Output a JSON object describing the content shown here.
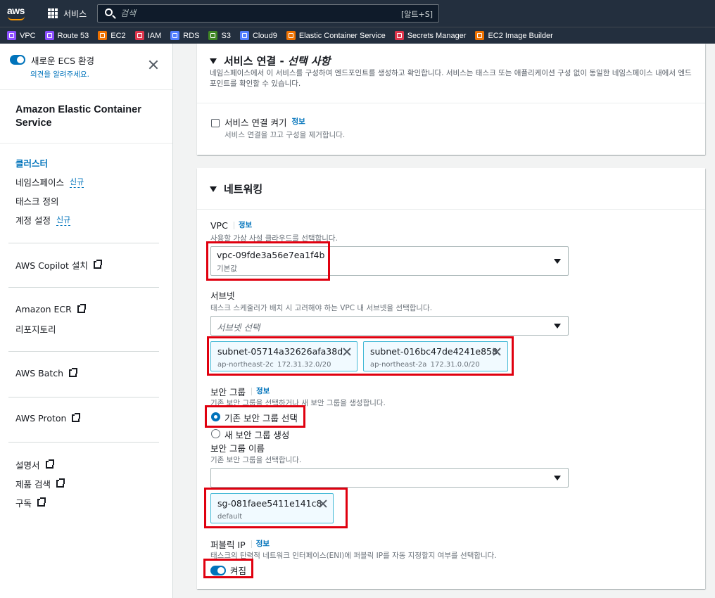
{
  "topbar": {
    "logo": "aws",
    "services": "서비스",
    "search_placeholder": "검색",
    "search_shortcut": "[알트+S]"
  },
  "favorites": [
    {
      "label": "VPC",
      "color": "#8c4fff"
    },
    {
      "label": "Route 53",
      "color": "#8c4fff"
    },
    {
      "label": "EC2",
      "color": "#ed7100"
    },
    {
      "label": "IAM",
      "color": "#dd344c"
    },
    {
      "label": "RDS",
      "color": "#527fff"
    },
    {
      "label": "S3",
      "color": "#3f8624"
    },
    {
      "label": "Cloud9",
      "color": "#527fff"
    },
    {
      "label": "Elastic Container Service",
      "color": "#ed7100"
    },
    {
      "label": "Secrets Manager",
      "color": "#dd344c"
    },
    {
      "label": "EC2 Image Builder",
      "color": "#ed7100"
    }
  ],
  "sidebar": {
    "new_ecs_label": "새로운 ECS 환경",
    "feedback": "의견을 알려주세요.",
    "title": "Amazon Elastic Container Service",
    "nav": [
      {
        "label": "클러스터",
        "badge": ""
      },
      {
        "label": "네임스페이스",
        "badge": "신규"
      },
      {
        "label": "태스크 정의",
        "badge": ""
      },
      {
        "label": "계정 설정",
        "badge": "신규"
      }
    ],
    "links": [
      "AWS Copilot 설치",
      "Amazon ECR",
      "리포지토리",
      "AWS Batch",
      "AWS Proton",
      "설명서",
      "제품 검색",
      "구독"
    ]
  },
  "service_connect": {
    "title_plain": "서비스 연결 - ",
    "title_italic": "선택 사항",
    "description": "네임스페이스에서 이 서비스를 구성하여 엔드포인트를 생성하고 확인합니다. 서비스는 태스크 또는 애플리케이션 구성 없이 동일한 네임스페이스 내에서 엔드포인트를 확인할 수 있습니다.",
    "checkbox_label": "서비스 연결 켜기",
    "info": "정보",
    "checkbox_desc": "서비스 연결을 끄고 구성을 제거합니다."
  },
  "networking": {
    "title": "네트워킹",
    "vpc": {
      "label": "VPC",
      "info": "정보",
      "desc": "사용할 가상 사설 클라우드를 선택합니다.",
      "value": "vpc-09fde3a56e7ea1f4b",
      "value_sub": "기본값"
    },
    "subnet": {
      "label": "서브넷",
      "desc": "태스크 스케줄러가 배치 시 고려해야 하는 VPC 내 서브넷을 선택합니다.",
      "placeholder": "서브넷 선택",
      "tokens": [
        {
          "id": "subnet-05714a32626afa38d",
          "az": "ap-northeast-2c",
          "cidr": "172.31.32.0/20"
        },
        {
          "id": "subnet-016bc47de4241e858",
          "az": "ap-northeast-2a",
          "cidr": "172.31.0.0/20"
        }
      ]
    },
    "security_group": {
      "label": "보안 그룹",
      "info": "정보",
      "desc": "기존 보안 그룹을 선택하거나 새 보안 그룹을 생성합니다.",
      "option_existing": "기존 보안 그룹 선택",
      "option_new": "새 보안 그룹 생성",
      "name_label": "보안 그룹 이름",
      "name_desc": "기존 보안 그룹을 선택합니다.",
      "token_id": "sg-081faee5411e141c8",
      "token_sub": "default"
    },
    "public_ip": {
      "label": "퍼블릭 IP",
      "info": "정보",
      "desc": "태스크의 탄력적 네트워크 인터페이스(ENI)에 퍼블릭 IP를 자동 지정할지 여부를 선택합니다.",
      "toggle_label": "켜짐"
    }
  }
}
